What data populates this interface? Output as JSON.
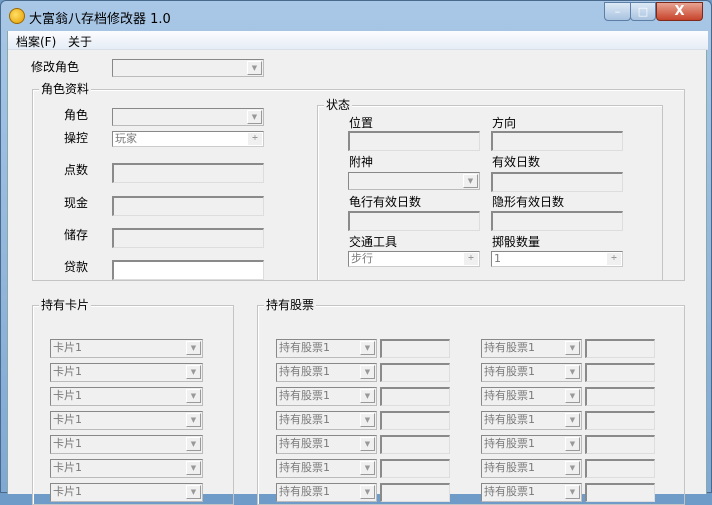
{
  "window": {
    "title": "大富翁八存档修改器 1.0",
    "minimize": "–",
    "maximize": "□",
    "close": "X"
  },
  "menu": [
    "档案(F)",
    "关于"
  ],
  "modify_role": {
    "label": "修改角色",
    "value": ""
  },
  "role_info": {
    "title": "角色资料",
    "role_label": "角色",
    "role_value": "",
    "control_label": "操控",
    "control_value": "玩家",
    "points_label": "点数",
    "cash_label": "现金",
    "savings_label": "储存",
    "loan_label": "贷款"
  },
  "status": {
    "title": "状态",
    "position_label": "位置",
    "direction_label": "方向",
    "deity_label": "附神",
    "valid_days_label": "有效日数",
    "turtle_days_label": "龟行有效日数",
    "invisible_days_label": "隐形有效日数",
    "vehicle_label": "交通工具",
    "vehicle_value": "步行",
    "dice_label": "掷骰数量",
    "dice_value": "1"
  },
  "cards": {
    "title": "持有卡片",
    "items": [
      "卡片1",
      "卡片1",
      "卡片1",
      "卡片1",
      "卡片1",
      "卡片1",
      "卡片1"
    ]
  },
  "stocks": {
    "title": "持有股票",
    "left": [
      "持有股票1",
      "持有股票1",
      "持有股票1",
      "持有股票1",
      "持有股票1",
      "持有股票1",
      "持有股票1"
    ],
    "right": [
      "持有股票1",
      "持有股票1",
      "持有股票1",
      "持有股票1",
      "持有股票1",
      "持有股票1",
      "持有股票1"
    ]
  },
  "icons": {
    "dropdown": "▼",
    "spin": "÷"
  }
}
